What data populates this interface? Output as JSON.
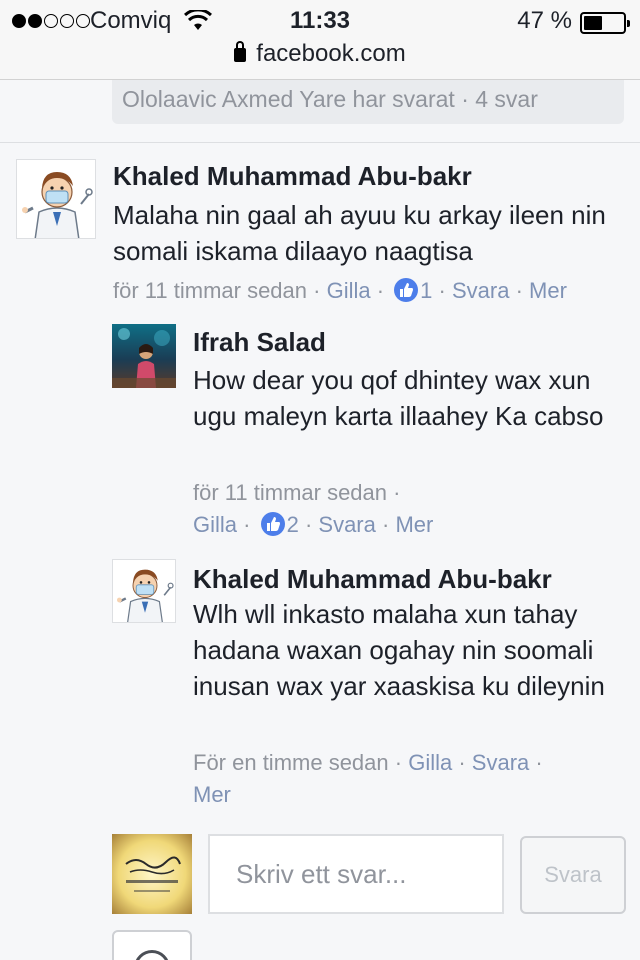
{
  "status_bar": {
    "carrier": "Comviq",
    "time": "11:33",
    "battery": "47 %",
    "battery_level": 0.47,
    "url": "facebook.com"
  },
  "replies_summary": "Ololaavic Axmed Yare har svarat · 4 svar",
  "comments": [
    {
      "author": "Khaled Muhammad Abu-bakr",
      "text": "Malaha nin gaal ah ayuu ku arkay ileen nin somali iskama dilaayo naagtisa",
      "time": "för 11 timmar sedan",
      "like": "Gilla",
      "like_count": "1",
      "reply": "Svara",
      "more": "Mer"
    },
    {
      "author": "Ifrah Salad",
      "text": "How dear you qof dhintey wax xun ugu maleyn karta illaahey Ka cabso",
      "time": "för 11 timmar sedan",
      "like": "Gilla",
      "like_count": "2",
      "reply": "Svara",
      "more": "Mer"
    },
    {
      "author": "Khaled Muhammad Abu-bakr",
      "text": "Wlh wll inkasto malaha xun tahay hadana waxan ogahay nin soomali inusan wax yar xaaskisa ku dileynin",
      "time": "För en timme sedan",
      "like": "Gilla",
      "reply": "Svara",
      "more": "Mer"
    }
  ],
  "reply_box": {
    "placeholder": "Skriv ett svar...",
    "button": "Svara"
  },
  "icons": {
    "wifi": "wifi-icon",
    "lock": "lock-icon",
    "like": "thumbs-up-icon",
    "doctor_avatar": "doctor-avatar",
    "more": "more-icon"
  },
  "colors": {
    "link": "#7f92b5",
    "meta": "#90949c",
    "like_blue": "#4d7eea"
  }
}
